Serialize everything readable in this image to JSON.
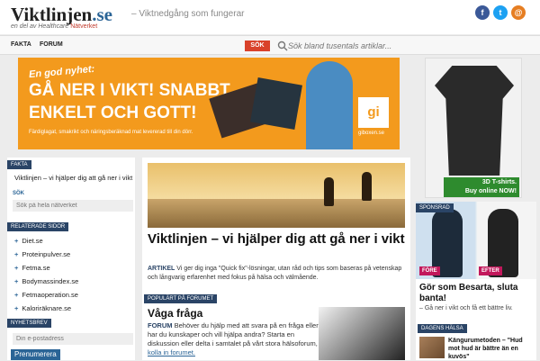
{
  "header": {
    "logo_main": "Viktlinjen",
    "logo_ext": ".se",
    "logo_sub_prefix": "en del av",
    "logo_sub_brand": "Healthcare",
    "logo_sub_red": "Nätverket",
    "tagline": "–    Viktnedgång som fungerar",
    "social": [
      {
        "icon": "facebook-icon",
        "glyph": "f",
        "color": "#3b5998"
      },
      {
        "icon": "twitter-icon",
        "glyph": "t",
        "color": "#1da1f2"
      },
      {
        "icon": "email-icon",
        "glyph": "@",
        "color": "#e67e22"
      }
    ]
  },
  "nav": {
    "items": [
      "FAKTA",
      "FORUM"
    ],
    "sok_label": "SÖK",
    "search_placeholder": "Sök bland tusentals artiklar..."
  },
  "banner": {
    "line1": "En god nyhet:",
    "line2": "GÅ NER I VIKT! SNABBT,",
    "line3": "ENKELT OCH GOTT!",
    "small": "Färdiglagat, smakrikt och näringsberäknad mat levererad till din dörr.",
    "logo": "gi",
    "logo_sub": "giboxen.se"
  },
  "side_ad": {
    "caption_line1": "3D T-shirts.",
    "caption_line2": "Buy online NOW!"
  },
  "left": {
    "fakta_tag": "FAKTA",
    "fakta_text": "Viktlinjen – vi hjälper dig att gå ner i vikt",
    "sok_label": "SÖK",
    "sok_placeholder": "Sök på hela nätverket",
    "related_tag": "RELATERADE SIDOR",
    "related": [
      "Diet.se",
      "Proteinpulver.se",
      "Fetma.se",
      "Bodymassindex.se",
      "Fetmaoperation.se",
      "Kaloriräknare.se"
    ],
    "newsletter_tag": "NYHETSBREV",
    "email_placeholder": "Din e-postadress",
    "subscribe": "Prenumerera"
  },
  "center": {
    "title": "Viktlinjen – vi hjälper dig att gå ner i vikt",
    "artikel_label": "ARTIKEL",
    "artikel_text": "Vi ger dig inga \"Quick fix\"-lösningar, utan råd och tips som baseras på vetenskap och långvarig erfarenhet med fokus på hälsa och välmående.",
    "popular_tag": "POPULÄRT PÅ FORUMET",
    "forum_title": "Våga fråga",
    "forum_label": "FORUM",
    "forum_text": "Behöver du hjälp med att svara på en fråga eller har du kunskaper och vill hjälpa andra? Starta en diskussion eller delta i samtalet på vårt stora hälsoforum,",
    "forum_link": "kolla in forumet."
  },
  "right": {
    "sponsor_tag": "SPONSRAD",
    "fore": "FÖRE",
    "efter": "EFTER",
    "title": "Gör som Besarta, sluta banta!",
    "sub": "– Gå ner i vikt och få ett bättre liv.",
    "daily_tag": "DAGENS HÄLSA",
    "news": "Kängurumetoden – \"Hud mot hud är bättre än en kuvös\""
  }
}
